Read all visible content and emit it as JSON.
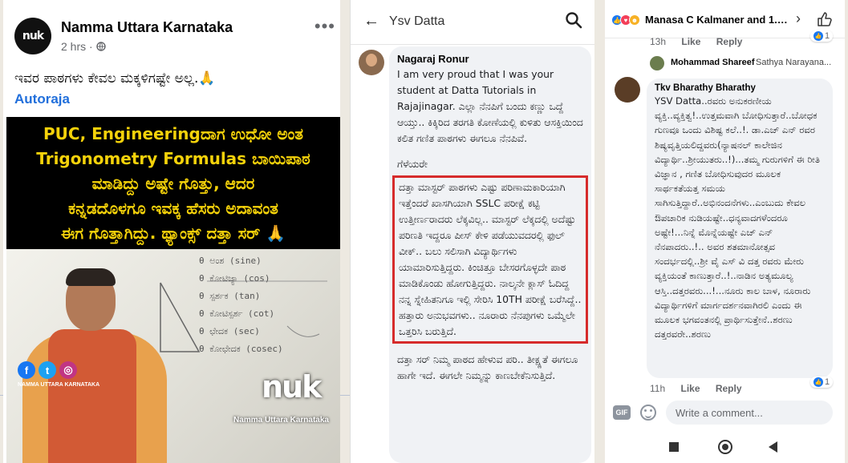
{
  "post": {
    "page_name": "Namma Uttara Karnataka",
    "time": "2 hrs · ",
    "globe_icon": "globe-icon",
    "more": "•••",
    "caption": "ಇವರ ಪಾಠಗಳು ಕೇವಲ ಮಕ್ಕಳಿಗಷ್ಟೇ ಅಲ್ಲ.🙏",
    "hashtag": "Autoraja",
    "avatar_text": "nuk",
    "poster_lines": [
      "PUC, Engineeringದಾಗ ಉಧೋ ಅಂತ",
      "Trigonometry Formulas ಬಾಯಿಪಾಠ",
      "ಮಾಡಿದ್ದು ಅಷ್ಟೇ ಗೊತ್ತು, ಆದರ",
      "ಕನ್ನಡದೊಳಗೂ ಇವಕ್ಕ ಹೆಸರು ಅದಾವಂತ",
      "ಈಗ ಗೊತ್ತಾಗಿದ್ದು. ಥ್ಯಾಂಕ್ಸ್ ದತ್ತಾ ಸರ್ 🙏"
    ],
    "social_handle": "NAMMA UTTARA KARNATAKA",
    "logo_text": "nuk",
    "logo_name": "Namma Uttara Karnataka",
    "board": [
      "θ ಅಂಶ (sine)",
      "θ ಕೋಟಿಜ್ಯಾ (cos)",
      "θ ಸ್ಪರ್ಶಕ (tan)",
      "θ ಕೋಟಿಸ್ಪರ್ಶ (cot)",
      "θ ಛೇದಕ (sec)",
      "θ ಕೋಛೇದಕ (cosec)"
    ]
  },
  "reply_view": {
    "title": "Ysv Datta",
    "comment": {
      "author": "Nagaraj Ronur",
      "intro": "I am very proud that I was your student at Datta Tutorials in Rajajinagar. ಎಲ್ಲಾ ನೆನಪಿಗೆ ಬಂದು ಕಣ್ಣು ಒದ್ದೆ ಆಯ್ತು.. ಕಿಕ್ಕಿರಿದ ತರಗತಿ ಕೋಣೆಯಲ್ಲಿ ಕುಳಿತು ಆಸಕ್ತಿಯಿಂದ ಕಲಿತ ಗಣಿತ ಪಾಠಗಳು ಈಗಲೂ ನೆನಪಿವೆ.",
      "greeting": "ಗೆಳೆಯರೇ",
      "highlighted": "ದತ್ತಾ ಮಾಸ್ಟರ್ ಪಾಠಗಳು ಎಷ್ಟು ಪರಿಣಾಮಕಾರಿಯಾಗಿ ಇತ್ತೆಂದರೆ ಖಾಸಗಿಯಾಗಿ SSLC ಪರೀಕ್ಷೆ ಕಟ್ಟಿ ಉತ್ತೀರ್ಣರಾದರು ಲೆಕ್ಕವಿಲ್ಲ.. ಮಾಸ್ಟರ್ ಲೆಕ್ಕದಲ್ಲಿ ಅದೆಷ್ಟು ಪರಿಣತಿ ಇದ್ದರೂ ಪೀಸ್ ಕೇಳಿ ಪಡೆಯುವದರಲ್ಲಿ ಫುಲ್ ವೀಕ್.. ಬಲು ಸಲಿಸಾಗಿ ವಿದ್ಯಾರ್ಥಿಗಳು ಯಾಮಾರಿಸುತ್ತಿದ್ದರು. ಕಿಂಚಿತ್ತೂ ಬೇಸರಗೊಳ್ಳದೇ ಪಾಠ ಮಾಡಿಕೊಂಡು ಹೋಗುತ್ತಿದ್ದರು. ನಾಲ್ಕನೇ ಕ್ಲಾಸ್ ಓದಿದ್ದ ನನ್ನ ಸ್ನೇಹಿತನಿಗೂ ಇಲ್ಲಿ ಸೇರಿಸಿ 10TH ಪರೀಕ್ಷೆ ಬರೆಸಿದ್ದೆ.. ಹತ್ತಾರು ಅನುಭವಗಳು.. ನೂರಾರು ನೆನಪುಗಳು ಒಮ್ಮೆಲೇ ಒತ್ತರಿಸಿ ಬರುತ್ತಿದೆ.",
      "tail": "ದತ್ತಾ ಸರ್ ನಿಮ್ಮ ಪಾಠದ ಹೇಳುವ ಪರಿ.. ತೀಕ್ಷ್ಣತೆ ಈಗಲೂ ಹಾಗೇ ಇದೆ. ಈಗಲೇ ನಿಮ್ಮನ್ನು ಕಾಣಬೇಕೆನಿಸುತ್ತಿದೆ."
    }
  },
  "thread": {
    "reactors": "Manasa C Kalmaner and 1.2...",
    "top_meta": {
      "time": "13h",
      "like": "Like",
      "reply": "Reply",
      "likes": "1"
    },
    "reply_preview": {
      "author": "Mohammad Shareef",
      "text": "Sathya Narayana..."
    },
    "comment": {
      "author": "Tkv Bharathy Bharathy",
      "text": "YSV Datta..ರವರು ಅನುಕರಣೀಯ ವ್ಯಕ್ತಿ..ವ್ಯಕ್ತಿತ್ವ!..ಉತ್ತಮವಾಗಿ ಬೋಧಿಸುತ್ತಾರೆ..ಬೋಧಕ ಗುಣವೂ ಒಂದು ವಿಶಿಷ್ಟ ಕಲೆ..!. ಡಾ.ಎಚ್ ಎನ್ ರವರ ಶಿಷ್ಯವೃತ್ತಿಯಲಿದ್ದವರು(ನ್ಯಾಷನಲ್ ಕಾಲೇಜಿನ ವಿದ್ಯಾರ್ಥಿ..ಶ್ರೀಯುತರು..!)...ತಮ್ಮ ಗುರುಗಳಿಗೆ ಈ ರೀತಿ ವಿಜ್ಞಾನ , ಗಣಿತ ಬೋಧಿಸುವುದರ ಮೂಲಕ ಸಾರ್ಥಕತೆಯತ್ತ ಸಮಯ ಸಾಗಿಸುತ್ತಿದ್ದಾರೆ..ಅಭಿನಂದನೆಗಳು..ಎಂಬುದು ಕೇವಲ ಔಪಚಾರಿಕ ನುಡಿಯಷ್ಟೇ..ಧನ್ಯವಾದಗಳೆಂದರೂ ಅಷ್ಟೇ!...ನಿನ್ನೆ ಮೊನ್ನೆಯಷ್ಟೇ ಎಚ್ ಎನ್ ನೆನಪಾದರು..!.. ಅವರ ಶತಮಾನೋತ್ಸವ ಸಂದರ್ಭದಲ್ಲಿ..ಶ್ರೀ ವೈ ಎಸ್ ವಿ ದತ್ತ ರವರು ಮೇರು ವ್ಯಕ್ತಿಯಂತೆ ಕಾಣುತ್ತಾರೆ..!..ನಾಡಿನ ಅತ್ಯಮೂಲ್ಯ ಆಸ್ತಿ..ದತ್ತರವರು...!...ನೂರು ಕಾಲ ಬಾಳ, ನೂರಾರು ವಿದ್ಯಾರ್ಥಿಗಳಿಗೆ ಮಾರ್ಗದರ್ಶನವಾಗಿರಲಿ ಎಂದು ಈ ಮೂಲಕ ಭಗವಂತನಲ್ಲಿ ಪ್ರಾರ್ಥಿಸುತ್ತೇನೆ..ಶರಣು ದತ್ತರವರೇ..ಶರಣು"
    },
    "bottom_meta": {
      "time": "11h",
      "like": "Like",
      "reply": "Reply",
      "likes": "1"
    },
    "gif_label": "GIF",
    "comment_placeholder": "Write a comment..."
  },
  "colors": {
    "facebook_blue": "#1877f2",
    "poster_yellow": "#f5d20a",
    "highlight_red": "#d62b2b",
    "bubble_grey": "#f0f2f5"
  }
}
